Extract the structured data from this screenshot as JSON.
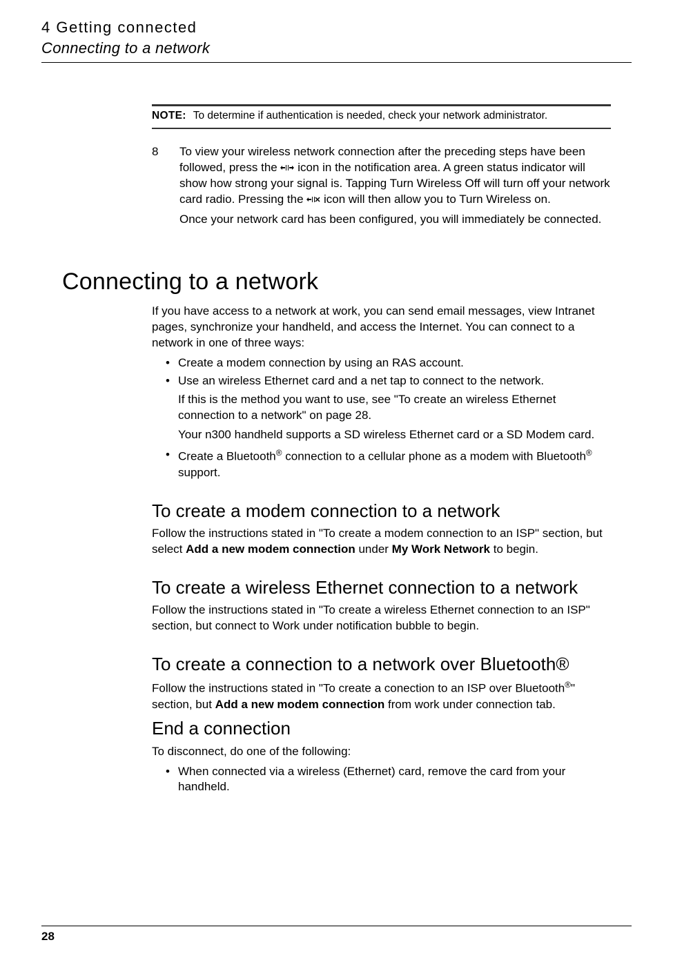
{
  "header": {
    "chapter": "4 Getting connected",
    "section": "Connecting to a network"
  },
  "note": {
    "label": "NOTE:",
    "text": "To determine if authentication is needed, check your network administrator."
  },
  "step8": {
    "number": "8",
    "p1a": "To view your wireless network connection after the preceding steps have been followed, press the ",
    "p1b": " icon in the notification area. A green status indicator will show how strong your signal is.  Tapping Turn Wireless Off will turn off your network card radio. Pressing the ",
    "p1c": " icon will then allow you to Turn Wireless on.",
    "p2": "Once your network card has been configured, you will immediately be connected."
  },
  "main": {
    "heading": "Connecting to a network",
    "intro": "If you have access to a network at work, you can send email messages, view Intranet pages, synchronize your handheld, and access the Internet. You can connect to a network in one of three ways:",
    "bullets": {
      "b1": "Create a modem connection by using an RAS account.",
      "b2": "Use an wireless Ethernet card and a net tap to connect to the network.",
      "b2sub1": "If this is the method you want to use, see \"To create an wireless Ethernet connection to a network\" on page 28.",
      "b2sub2": "Your n300 handheld supports a SD wireless Ethernet card or a SD Modem card.",
      "b3a": "Create a Bluetooth",
      "b3b": " connection to a cellular phone as a modem with Bluetooth",
      "b3c": " support."
    }
  },
  "subs": {
    "s1": {
      "heading": "To create a modem connection to a network",
      "p_pre": "Follow the instructions stated in \"To create a modem connection to an ISP\" section, but select ",
      "bold1": "Add a new modem connection",
      "mid": " under ",
      "bold2": "My Work Network",
      "post": " to begin."
    },
    "s2": {
      "heading": "To create a wireless Ethernet connection to a network",
      "p": "Follow the instructions stated in \"To create a wireless Ethernet connection to an ISP\" section, but  connect to Work under notification bubble to begin."
    },
    "s3": {
      "heading_a": "To create a connection to a network over Bluetooth",
      "heading_reg": "®",
      "p_pre": "Follow the instructions stated in \"To create a conection to an ISP over Bluetooth",
      "p_reg": "®",
      "p_mid": "\" section, but ",
      "bold1": "Add a new modem connection",
      "p_post": " from work under connection tab."
    },
    "s4": {
      "heading": "End a connection",
      "p": "To disconnect, do one of the following:",
      "bullet": "When connected via a wireless (Ethernet) card, remove the card from your handheld."
    }
  },
  "footer": {
    "page": "28"
  }
}
